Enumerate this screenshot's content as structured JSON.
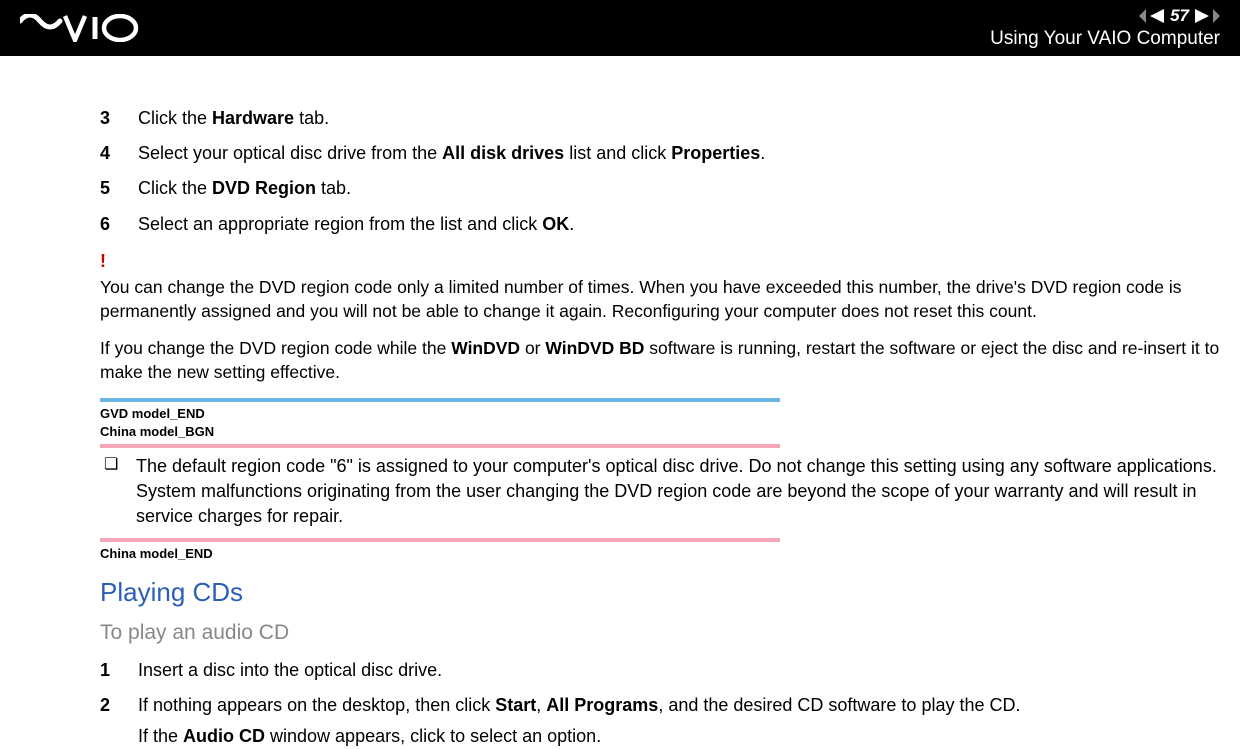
{
  "header": {
    "page_number": "57",
    "title": "Using Your VAIO Computer"
  },
  "steps_a": [
    {
      "n": "3",
      "parts": [
        "Click the ",
        "Hardware",
        " tab."
      ]
    },
    {
      "n": "4",
      "parts": [
        "Select your optical disc drive from the ",
        "All disk drives",
        " list and click ",
        "Properties",
        "."
      ]
    },
    {
      "n": "5",
      "parts": [
        "Click the ",
        "DVD Region",
        " tab."
      ]
    },
    {
      "n": "6",
      "parts": [
        "Select an appropriate region from the list and click ",
        "OK",
        "."
      ]
    }
  ],
  "caution": {
    "mark": "!",
    "para1": "You can change the DVD region code only a limited number of times. When you have exceeded this number, the drive's DVD region code is permanently assigned and you will not be able to change it again. Reconfiguring your computer does not reset this count.",
    "para2_parts": [
      "If you change the DVD region code while the ",
      "WinDVD",
      " or ",
      "WinDVD BD",
      " software is running, restart the software or eject the disc and re-insert it to make the new setting effective."
    ]
  },
  "model_labels": {
    "gvd_end": "GVD model_END",
    "china_bgn": "China model_BGN",
    "china_end": "China model_END"
  },
  "bullet": {
    "sym": "❏",
    "text": "The default region code \"6\" is assigned to your computer's optical disc drive. Do not change this setting using any software applications. System malfunctions originating from the user changing the DVD region code are beyond the scope of your warranty and will result in service charges for repair."
  },
  "section": {
    "heading": "Playing CDs",
    "subheading": "To play an audio CD"
  },
  "steps_b": [
    {
      "n": "1",
      "parts": [
        "Insert a disc into the optical disc drive."
      ]
    },
    {
      "n": "2",
      "parts": [
        "If nothing appears on the desktop, then click ",
        "Start",
        ", ",
        "All Programs",
        ", and the desired CD software to play the CD."
      ],
      "sub_parts": [
        "If the ",
        "Audio CD",
        " window appears, click to select an option."
      ]
    }
  ]
}
